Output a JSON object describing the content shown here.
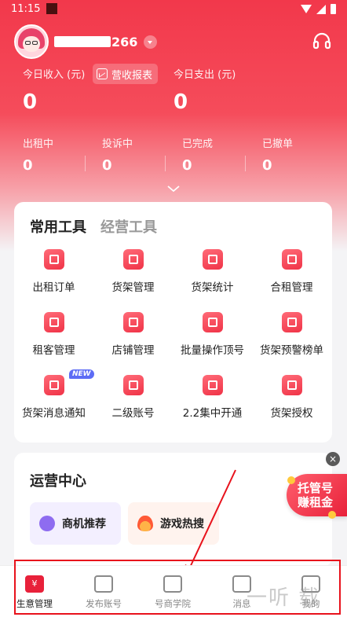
{
  "status_bar": {
    "time": "11:15"
  },
  "profile": {
    "name_suffix": "266"
  },
  "finance": {
    "income_label": "今日收入 (元)",
    "income_value": "0",
    "report_button": "营收报表",
    "expense_label": "今日支出 (元)",
    "expense_value": "0"
  },
  "stats": [
    {
      "label": "出租中",
      "value": "0"
    },
    {
      "label": "投诉中",
      "value": "0"
    },
    {
      "label": "已完成",
      "value": "0"
    },
    {
      "label": "已撤单",
      "value": "0"
    }
  ],
  "tools": {
    "tabs": [
      {
        "label": "常用工具",
        "active": true
      },
      {
        "label": "经营工具",
        "active": false
      }
    ],
    "items": [
      {
        "label": "出租订单",
        "icon": "clipboard-icon"
      },
      {
        "label": "货架管理",
        "icon": "shelf-icon"
      },
      {
        "label": "货架统计",
        "icon": "chart-icon"
      },
      {
        "label": "合租管理",
        "icon": "layers-icon"
      },
      {
        "label": "租客管理",
        "icon": "person-icon"
      },
      {
        "label": "店铺管理",
        "icon": "store-icon"
      },
      {
        "label": "批量操作顶号",
        "icon": "batch-icon"
      },
      {
        "label": "货架预警榜单",
        "icon": "alert-icon"
      },
      {
        "label": "货架消息通知",
        "icon": "robot-icon",
        "badge": "NEW"
      },
      {
        "label": "二级账号",
        "icon": "sub-account-icon"
      },
      {
        "label": "2.2集中开通",
        "icon": "check-icon"
      },
      {
        "label": "货架授权",
        "icon": "shield-icon"
      }
    ]
  },
  "ops": {
    "title": "运营中心",
    "buttons": [
      {
        "label": "商机推荐",
        "icon": "recommend-icon"
      },
      {
        "label": "游戏热搜",
        "icon": "flame-icon"
      }
    ]
  },
  "promo": {
    "line1": "托管号",
    "line2": "赚租金",
    "close": "×"
  },
  "tabbar": [
    {
      "label": "生意管理",
      "icon": "business-icon",
      "active": true
    },
    {
      "label": "发布账号",
      "icon": "publish-icon",
      "active": false
    },
    {
      "label": "号商学院",
      "icon": "book-icon",
      "active": false
    },
    {
      "label": "消息",
      "icon": "message-icon",
      "active": false
    },
    {
      "label": "我的",
      "icon": "profile-icon",
      "active": false
    }
  ],
  "watermark": "一听 载",
  "colors": {
    "primary": "#e8213a",
    "hero_top": "#f2384b",
    "annotation": "#e8121c"
  }
}
